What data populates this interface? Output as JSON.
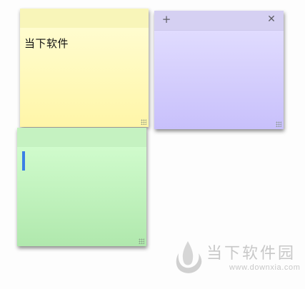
{
  "notes": {
    "yellow": {
      "text": "当下软件",
      "color": "#fff6a8"
    },
    "purple": {
      "add_icon": "+",
      "close_icon": "✕",
      "color": "#d5d0f2"
    },
    "green": {
      "color": "#c5f2c1"
    }
  },
  "watermark": {
    "title": "当下软件园",
    "url": "www.downxia.com"
  }
}
